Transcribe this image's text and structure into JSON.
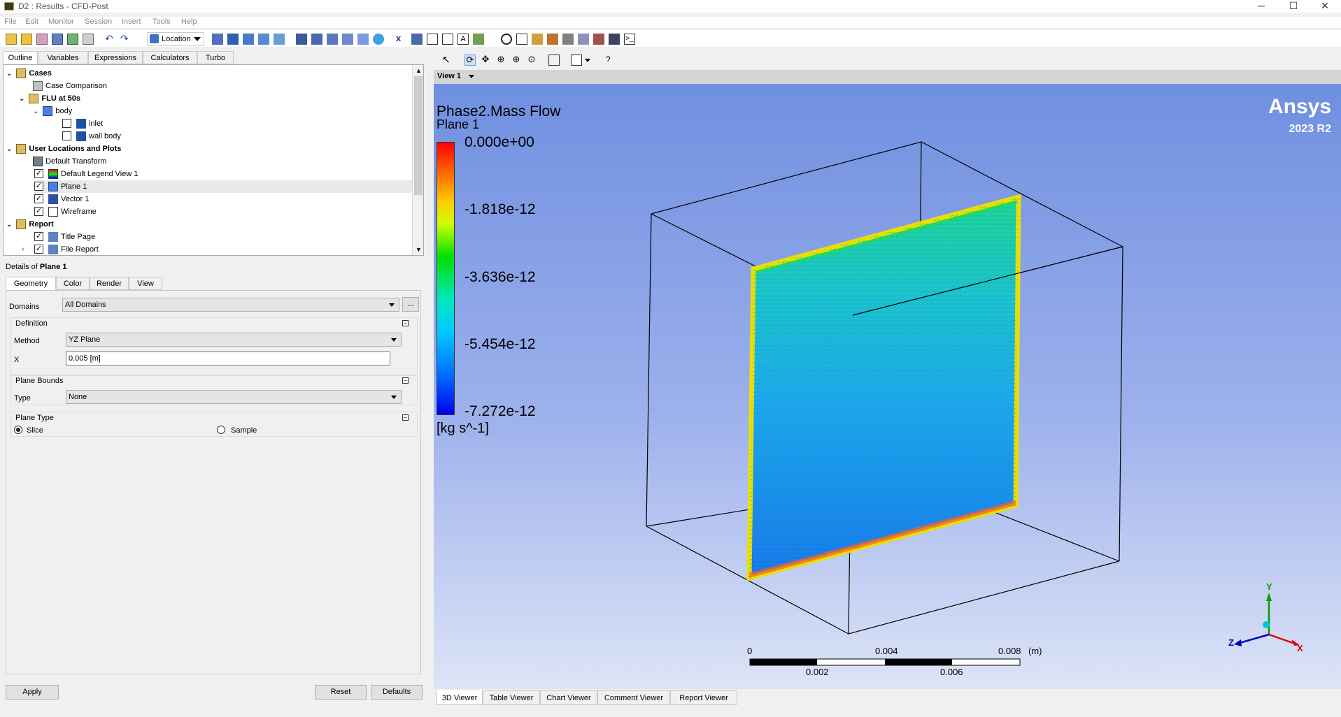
{
  "window": {
    "title": "D2 : Results - CFD-Post"
  },
  "menu": [
    "File",
    "Edit",
    "Monitor",
    "Session",
    "Insert",
    "Tools",
    "Help"
  ],
  "toolbar": {
    "location_label": "Location"
  },
  "left_tabs": [
    "Outline",
    "Variables",
    "Expressions",
    "Calculators",
    "Turbo"
  ],
  "tree": {
    "cases": "Cases",
    "case_comparison": "Case Comparison",
    "flu": "FLU at 50s",
    "body": "body",
    "inlet": "inlet",
    "wall_body": "wall body",
    "user_locations": "User Locations and Plots",
    "default_transform": "Default Transform",
    "default_legend": "Default Legend View 1",
    "plane1": "Plane 1",
    "vector1": "Vector 1",
    "wireframe": "Wireframe",
    "report": "Report",
    "title_page": "Title Page",
    "file_report": "File Report"
  },
  "details": {
    "header_prefix": "Details of ",
    "header_obj": "Plane 1",
    "tabs": [
      "Geometry",
      "Color",
      "Render",
      "View"
    ],
    "domains_label": "Domains",
    "domains_value": "All Domains",
    "more_button": "...",
    "definition_label": "Definition",
    "method_label": "Method",
    "method_value": "YZ Plane",
    "x_label": "X",
    "x_value": "0.005 [m]",
    "plane_bounds_label": "Plane Bounds",
    "type_label": "Type",
    "type_value": "None",
    "plane_type_label": "Plane Type",
    "slice_label": "Slice",
    "sample_label": "Sample",
    "apply": "Apply",
    "reset": "Reset",
    "defaults": "Defaults"
  },
  "viewer": {
    "view_label": "View 1",
    "legend_title": "Phase2.Mass Flow",
    "legend_sub": "Plane 1",
    "legend_ticks": [
      "0.000e+00",
      "-1.818e-12",
      "-3.636e-12",
      "-5.454e-12",
      "-7.272e-12"
    ],
    "legend_unit": "[kg s^-1]",
    "brand": "Ansys",
    "version": "2023 R2",
    "scale_top": [
      "0",
      "0.004",
      "0.008",
      "(m)"
    ],
    "scale_bottom": [
      "0.002",
      "0.006"
    ],
    "axis_x": "X",
    "axis_y": "Y",
    "axis_z": "Z",
    "colors": {
      "background_top": "#6f8fe0",
      "background_bottom": "#dde4f7"
    }
  },
  "viewer_tabs": [
    "3D Viewer",
    "Table Viewer",
    "Chart Viewer",
    "Comment Viewer",
    "Report Viewer"
  ]
}
